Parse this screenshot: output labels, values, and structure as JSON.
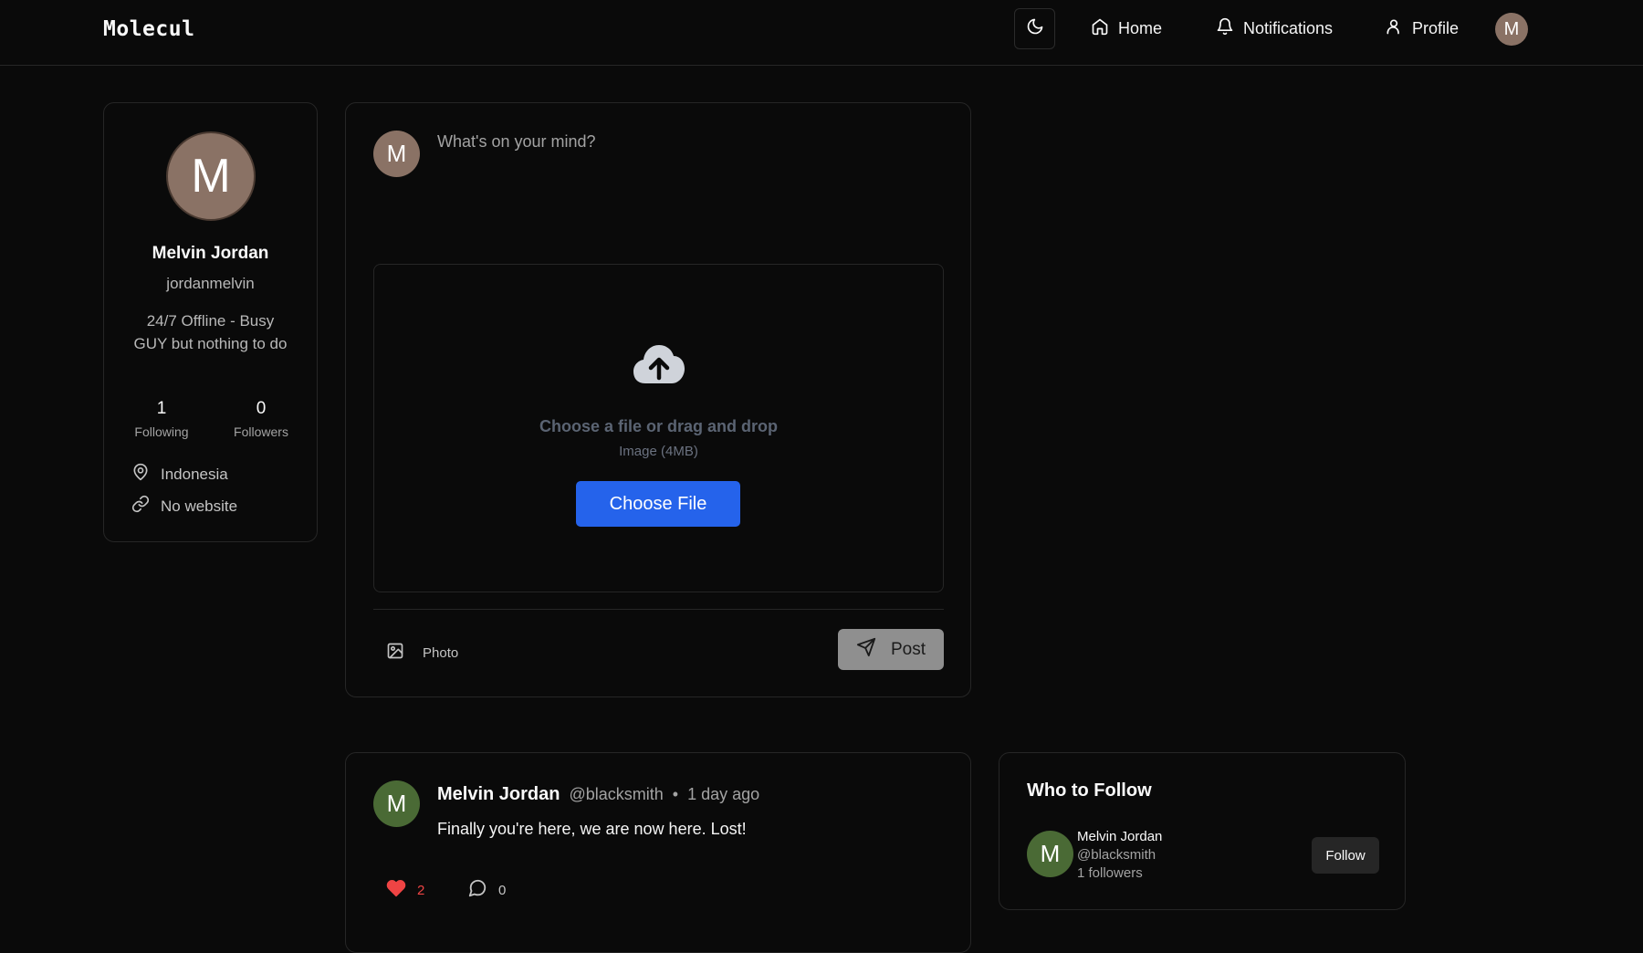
{
  "app": {
    "logo": "Molecul"
  },
  "nav": {
    "home": "Home",
    "notifications": "Notifications",
    "profile": "Profile",
    "avatar_initial": "M"
  },
  "profile": {
    "initial": "M",
    "name": "Melvin Jordan",
    "handle": "jordanmelvin",
    "bio": "24/7 Offline - Busy GUY but nothing to do",
    "following_count": "1",
    "following_label": "Following",
    "followers_count": "0",
    "followers_label": "Followers",
    "location": "Indonesia",
    "website": "No website"
  },
  "composer": {
    "avatar_initial": "M",
    "placeholder": "What's on your mind?",
    "dropzone_title": "Choose a file or drag and drop",
    "dropzone_subtitle": "Image (4MB)",
    "choose_file_label": "Choose File",
    "photo_label": "Photo",
    "post_label": "Post"
  },
  "feed": {
    "posts": [
      {
        "avatar_initial": "M",
        "author": "Melvin Jordan",
        "handle": "@blacksmith",
        "separator": "•",
        "time": "1 day ago",
        "text": "Finally you're here, we are now here. Lost!",
        "likes": "2",
        "comments": "0"
      }
    ]
  },
  "who_to_follow": {
    "title": "Who to Follow",
    "users": [
      {
        "avatar_initial": "M",
        "name": "Melvin Jordan",
        "handle": "@blacksmith",
        "followers": "1 followers",
        "follow_label": "Follow"
      }
    ]
  },
  "colors": {
    "background": "#0a0a0a",
    "accent": "#2563eb",
    "like": "#ef4444",
    "avatar_brown": "#8a7265",
    "avatar_green": "#4a6a35"
  }
}
